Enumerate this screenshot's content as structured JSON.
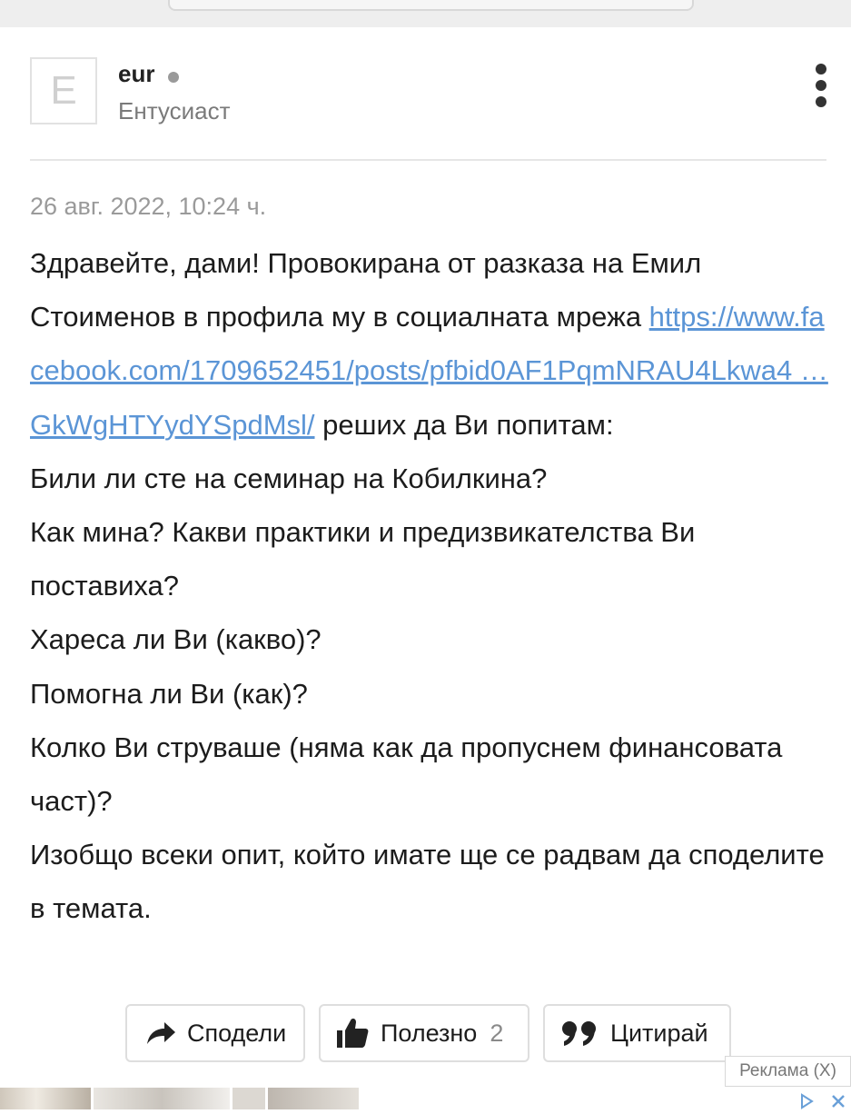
{
  "user": {
    "avatar_letter": "E",
    "name": "eur",
    "role": "Ентусиаст"
  },
  "post": {
    "date": "26 авг. 2022, 10:24 ч.",
    "intro": "Здравейте, дами! Провокирана от разказа на Емил Стоименов в профила му в социалната мрежа ",
    "link_text": "https://www.facebook.com/1709652451/posts/pfbid0AF1PqmNRAU4Lkwa4 … GkWgHTYydYSpdMsl/",
    "after_link": " реших да Ви попитам:",
    "lines": [
      "Били ли сте на семинар на Кобилкина?",
      "Как мина? Какви практики и предизвикателства Ви поставиха?",
      "Хареса ли Ви (какво)?",
      "Помогна ли Ви (как)?",
      "Колко Ви струваше (няма как да пропуснем финансовата част)?",
      "Изобщо всеки опит, който имате ще се радвам да споделите в темата."
    ]
  },
  "actions": {
    "share_label": "Сподели",
    "useful_label": "Полезно",
    "useful_count": "2",
    "quote_label": "Цитирай"
  },
  "ad": {
    "label": "Реклама (X)"
  },
  "colors": {
    "link": "#5b95d6",
    "muted": "#9a9a9a",
    "text": "#1c1c1c"
  },
  "icons": [
    "more-vertical-icon",
    "share-arrow-icon",
    "thumbs-up-icon",
    "quote-icon",
    "adchoices-icon"
  ]
}
